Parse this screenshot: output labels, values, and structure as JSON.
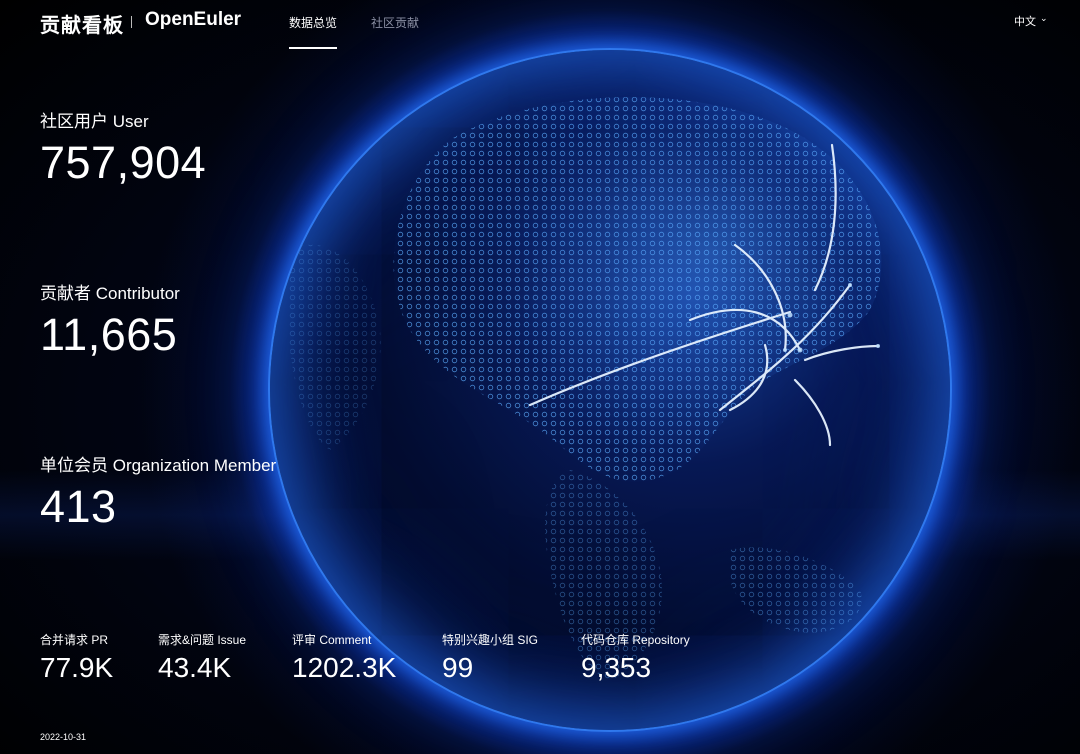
{
  "header": {
    "brand": "贡献看板",
    "logo_text": "OpenEuler",
    "tabs": [
      {
        "label": "数据总览",
        "active": true
      },
      {
        "label": "社区贡献",
        "active": false
      }
    ],
    "language": "中文"
  },
  "stats": [
    {
      "label": "社区用户 User",
      "value": "757,904"
    },
    {
      "label": "贡献者 Contributor",
      "value": "11,665"
    },
    {
      "label": "单位会员 Organization Member",
      "value": "413"
    }
  ],
  "metrics": [
    {
      "label": "合并请求 PR",
      "value": "77.9K"
    },
    {
      "label": "需求&问题 Issue",
      "value": "43.4K"
    },
    {
      "label": "评审 Comment",
      "value": "1202.3K"
    },
    {
      "label": "特别兴趣小组 SIG",
      "value": "99"
    },
    {
      "label": "代码仓库 Repository",
      "value": "9,353"
    }
  ],
  "footer": {
    "date": "2022-10-31"
  },
  "colors": {
    "background": "#000000",
    "globe_glow": "#2a78ff",
    "text": "#ffffff",
    "tab_inactive": "#8a8fa3"
  },
  "icons": {
    "language_dropdown": "chevron-down-icon"
  }
}
